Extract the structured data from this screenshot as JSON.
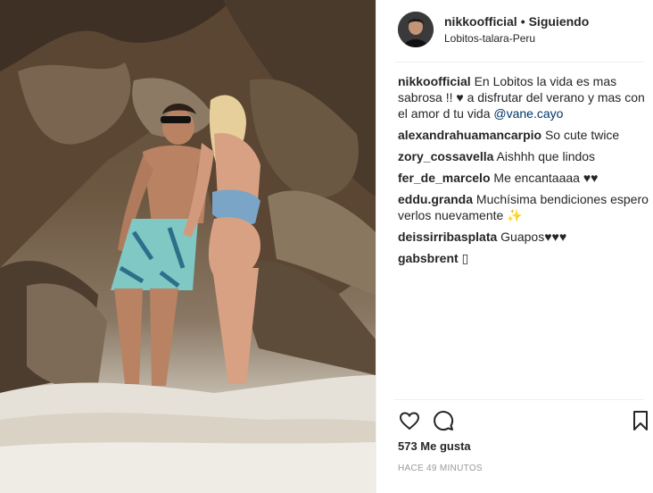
{
  "post": {
    "author": "nikkoofficial",
    "follow_status": "Siguiendo",
    "separator": "•",
    "location": "Lobitos-talara-Peru"
  },
  "comments": [
    {
      "user": "nikkoofficial",
      "text": "En Lobitos la vida es mas sabrosa !! ♥ a disfrutar del verano y mas con el amor d tu vida ",
      "mention": "@vane.cayo"
    },
    {
      "user": "alexandrahuamancarpio",
      "text": "So cute twice"
    },
    {
      "user": "zory_cossavella",
      "text": "Aishhh que lindos"
    },
    {
      "user": "fer_de_marcelo",
      "text": "Me encantaaaa ♥♥"
    },
    {
      "user": "eddu.granda",
      "text": "Muchísima bendiciones espero verlos nuevamente ✨"
    },
    {
      "user": "deissirribasplata",
      "text": "Guapos♥♥♥"
    },
    {
      "user": "gabsbrent",
      "text": "▯"
    }
  ],
  "actions": {
    "like_icon": "heart-outline-icon",
    "comment_icon": "comment-bubble-icon",
    "save_icon": "bookmark-icon"
  },
  "likes_label": "573 Me gusta",
  "timestamp": "HACE 49 MINUTOS",
  "colors": {
    "mention": "#003569",
    "muted": "#999999",
    "divider": "#efefef"
  }
}
